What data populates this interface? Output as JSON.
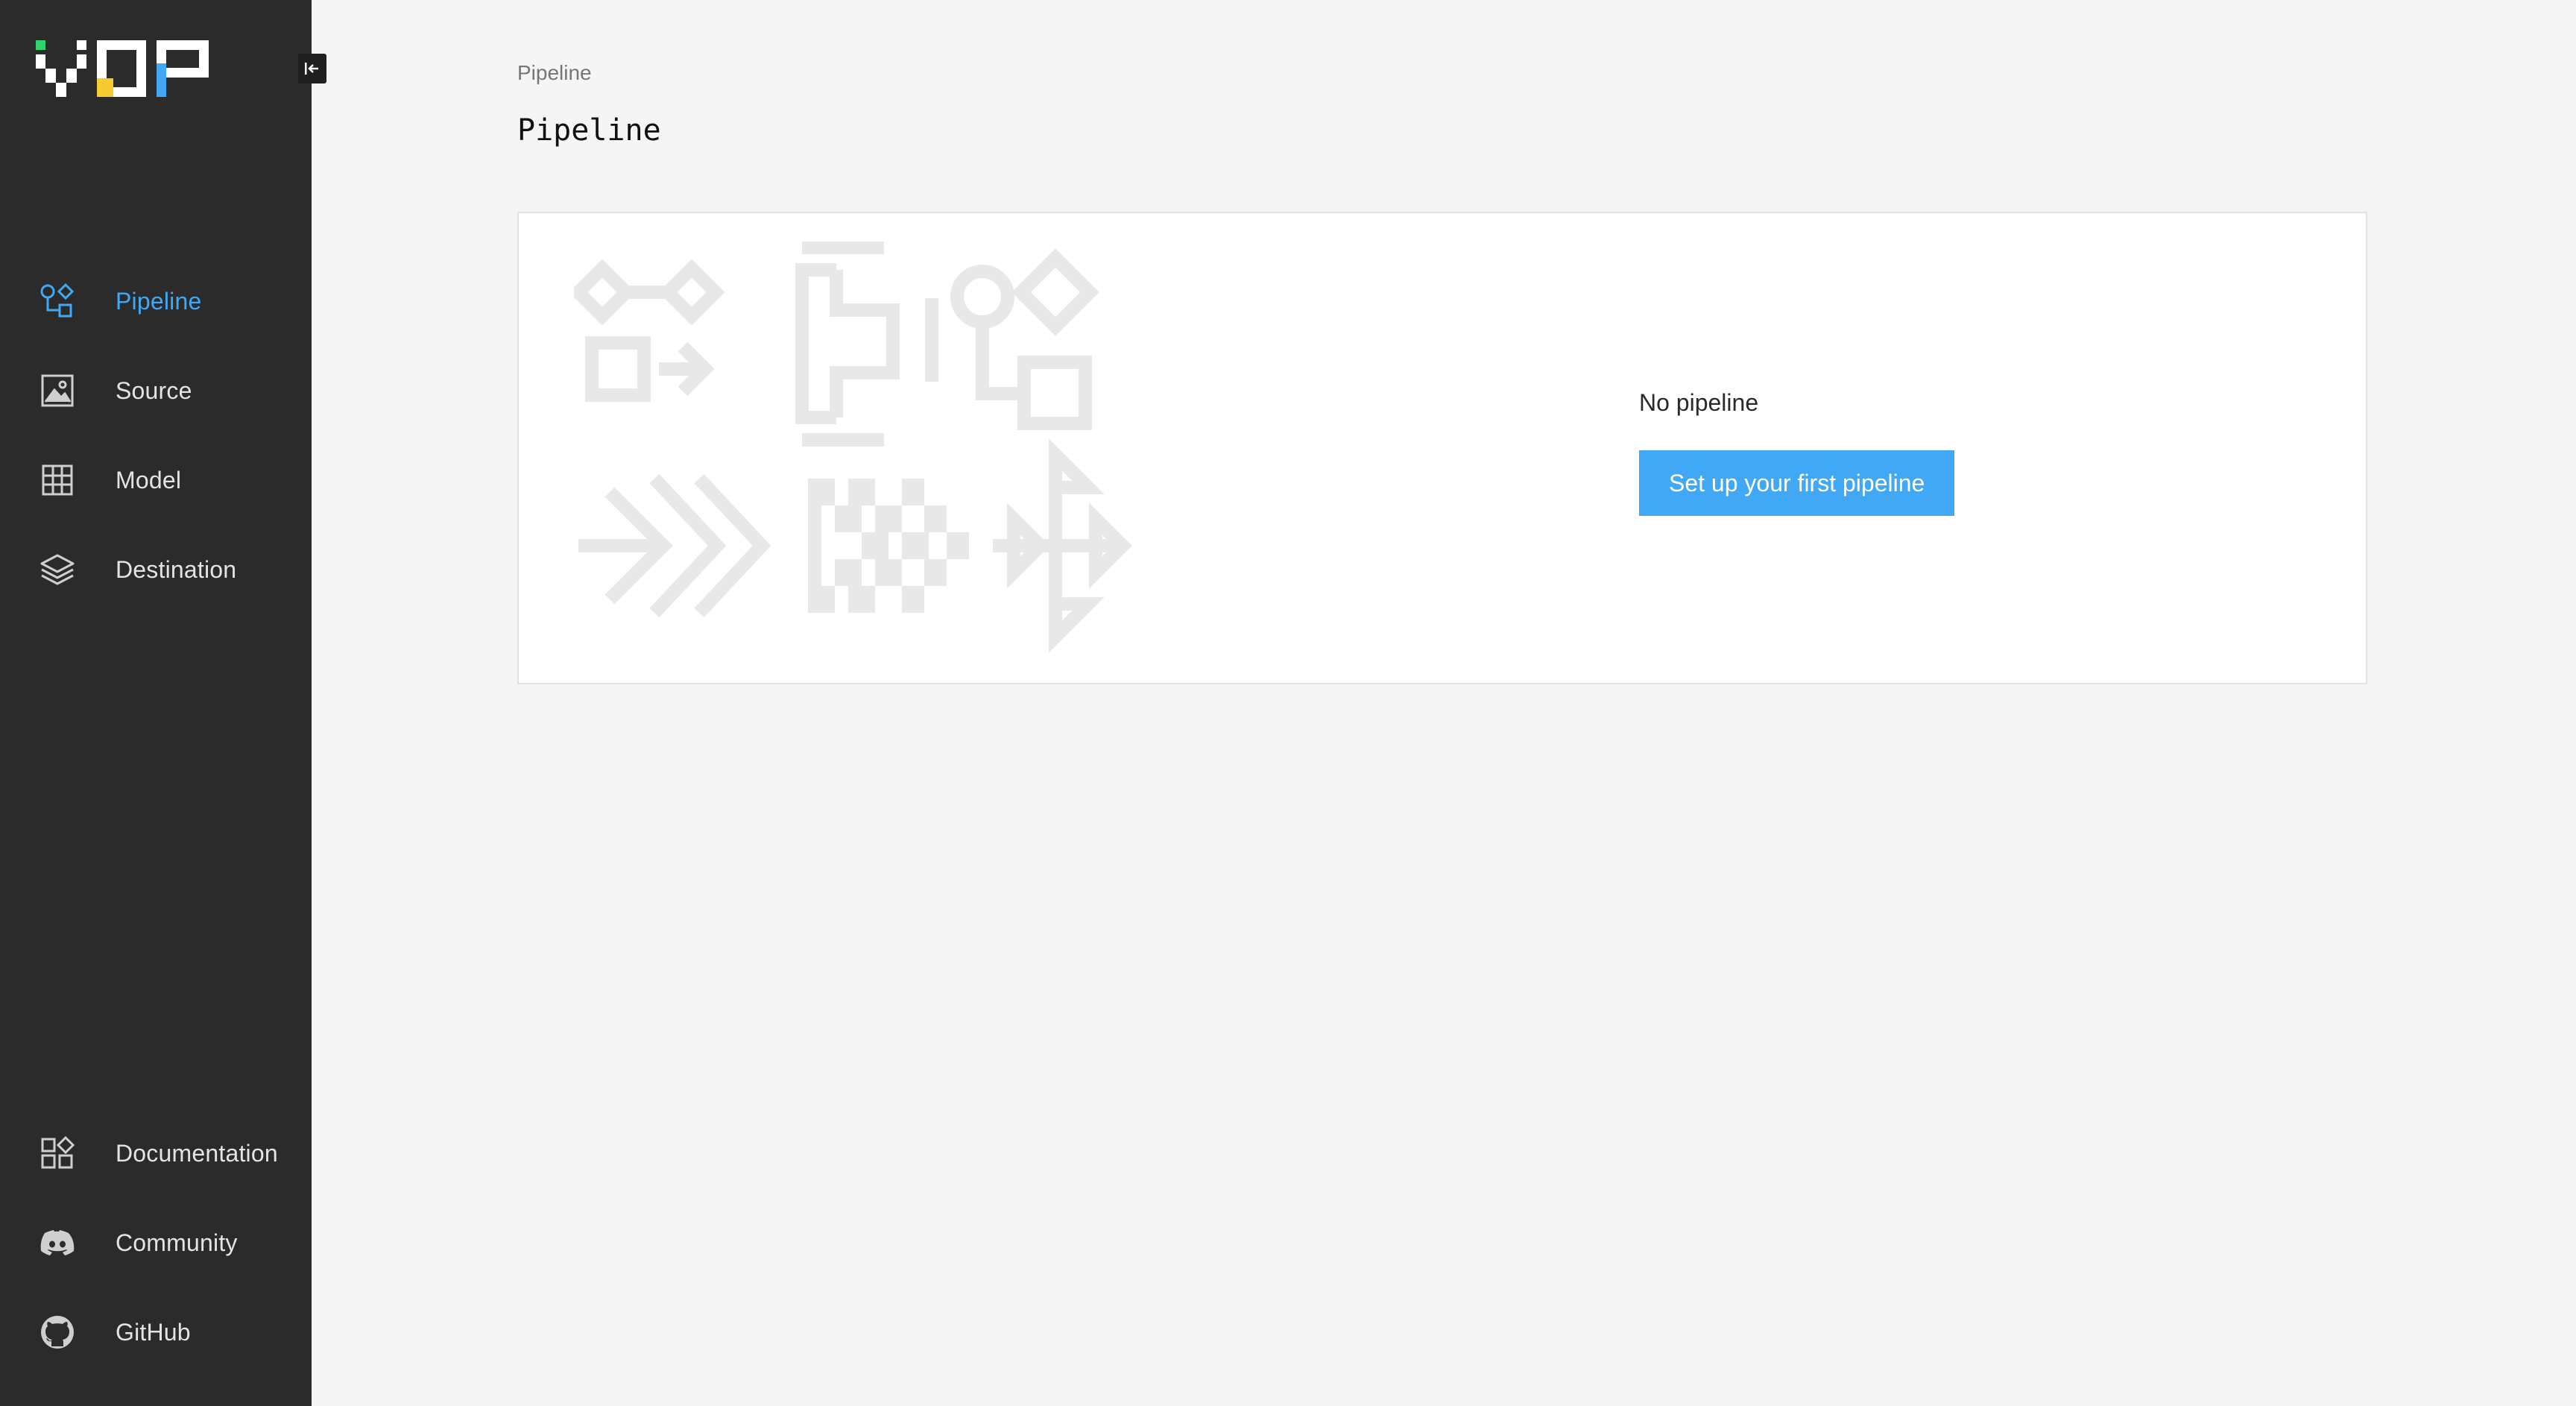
{
  "sidebar": {
    "logo_text": "VDP",
    "collapse_button": "collapse-sidebar",
    "nav_top": [
      {
        "label": "Pipeline",
        "icon": "pipeline-icon",
        "active": true
      },
      {
        "label": "Source",
        "icon": "image-icon",
        "active": false
      },
      {
        "label": "Model",
        "icon": "grid-icon",
        "active": false
      },
      {
        "label": "Destination",
        "icon": "layers-icon",
        "active": false
      }
    ],
    "nav_bottom": [
      {
        "label": "Documentation",
        "icon": "documentation-icon"
      },
      {
        "label": "Community",
        "icon": "discord-icon"
      },
      {
        "label": "GitHub",
        "icon": "github-icon"
      }
    ]
  },
  "main": {
    "breadcrumb": "Pipeline",
    "title": "Pipeline",
    "empty_state": {
      "message": "No pipeline",
      "button_label": "Set up your first pipeline"
    }
  },
  "colors": {
    "sidebar_bg": "#2b2b2b",
    "accent": "#40a8f5",
    "page_bg": "#f5f5f5",
    "logo_green": "#2ed36a",
    "logo_yellow": "#f7cb2f",
    "logo_blue": "#40a8f5"
  }
}
